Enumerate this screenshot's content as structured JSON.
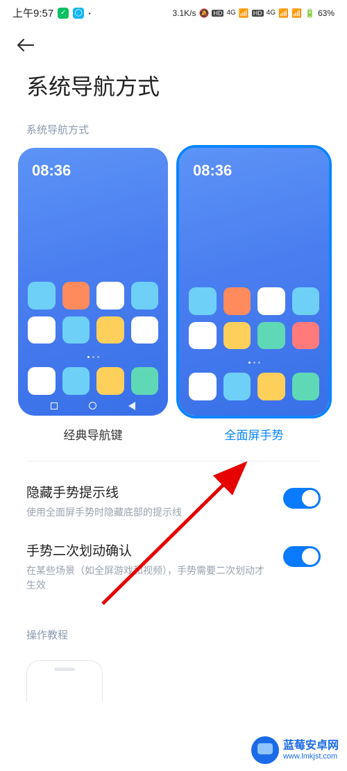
{
  "status": {
    "time": "上午9:57",
    "speed": "3.1K/s",
    "hd1": "HD",
    "net1": "4G",
    "hd2": "HD",
    "net2": "4G",
    "battery": "63%"
  },
  "title": "系统导航方式",
  "section_nav": "系统导航方式",
  "preview_time": "08:36",
  "nav_options": {
    "classic": "经典导航键",
    "gesture": "全面屏手势"
  },
  "icon_colors": [
    "#6ed0f7",
    "#ff8a5c",
    "#ffffff",
    "#6ed0f7",
    "#ffffff",
    "#6ed0f7",
    "#ffcf5c",
    "#ffffff"
  ],
  "dock_colors": [
    "#ffffff",
    "#6ed0f7",
    "#ffcf5c",
    "#5fd9b5"
  ],
  "icon_colors2": [
    "#6ed0f7",
    "#ff8a5c",
    "#ffffff",
    "#6ed0f7",
    "#ffffff",
    "#ffcf5c",
    "#5fd9b5",
    "#ff7b7b"
  ],
  "dock_colors2": [
    "#ffffff",
    "#6ed0f7",
    "#ffcf5c",
    "#5fd9b5"
  ],
  "settings": {
    "hide_hint": {
      "title": "隐藏手势提示线",
      "desc": "使用全面屏手势时隐藏底部的提示线"
    },
    "double_swipe": {
      "title": "手势二次划动确认",
      "desc": "在某些场景（如全屏游戏和视频），手势需要二次划动才生效"
    }
  },
  "tutorial_label": "操作教程",
  "watermark": {
    "name": "蓝莓安卓网",
    "url": "www.lmkjst.com"
  }
}
